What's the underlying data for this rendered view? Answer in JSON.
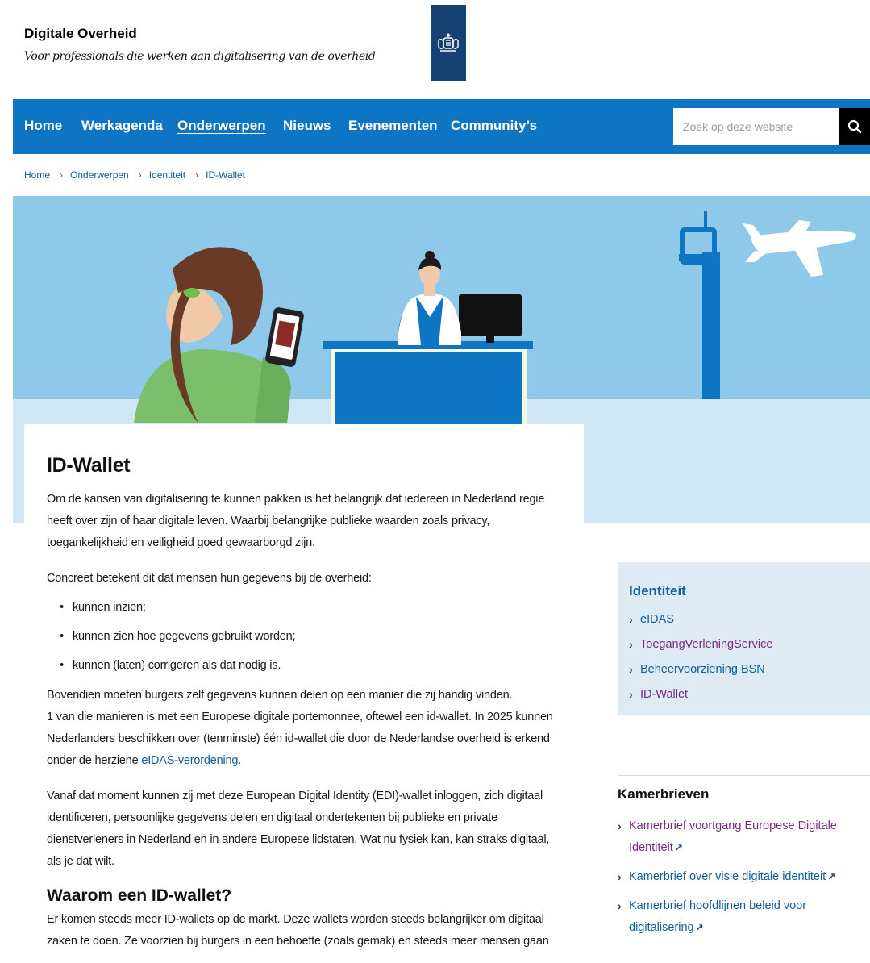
{
  "header": {
    "site_title": "Digitale Overheid",
    "tagline": "Voor professionals die werken aan digitalisering van de overheid",
    "logo_icon": "rijksoverheid-coat-of-arms-icon"
  },
  "nav": {
    "items": [
      {
        "label": "Home",
        "active": false
      },
      {
        "label": "Werkagenda",
        "active": false
      },
      {
        "label": "Onderwerpen",
        "active": true
      },
      {
        "label": "Nieuws",
        "active": false
      },
      {
        "label": "Evenementen",
        "active": false
      },
      {
        "label": "Community’s",
        "active": false
      }
    ],
    "search_placeholder": "Zoek op deze website",
    "search_icon": "search-icon"
  },
  "breadcrumb": [
    "Home",
    "Onderwerpen",
    "Identiteit",
    "ID-Wallet"
  ],
  "article": {
    "title": "ID-Wallet",
    "intro": "Om de kansen van digitalisering te kunnen pakken is het belangrijk dat iedereen in Nederland regie heeft over zijn of haar digitale leven. Waarbij belangrijke publieke waarden zoals privacy, toegankelijkheid en veiligheid goed gewaarborgd zijn.",
    "concreet": "Concreet betekent dit dat mensen hun gegevens bij de overheid:",
    "bullets": [
      "kunnen inzien;",
      "kunnen zien hoe gegevens gebruikt worden;",
      "kunnen (laten) corrigeren als dat nodig is."
    ],
    "bovendien": "Bovendien moeten burgers zelf gegevens kunnen delen op een manier die zij handig vinden.",
    "manieren": "1 van die manieren is met een Europese digitale portemonnee, oftewel een id-wallet. In 2025 kunnen Nederlanders beschikken over (tenminste) één id-wallet die door de Nederlandse overheid is erkend onder de herziene ",
    "eidas_link": "eIDAS-verordening.",
    "vanaf": "Vanaf dat moment kunnen zij met deze European Digital Identity (EDI)-wallet inloggen, zich digitaal identificeren, persoonlijke gegevens delen en digitaal ondertekenen bij publieke en private dienstverleners in Nederland en in andere Europese lidstaten. Wat nu fysiek kan, kan straks digitaal, als je dat wilt.",
    "subheading": "Waarom een ID-wallet?",
    "waarom": "Er komen steeds meer ID-wallets op de markt. Deze wallets worden steeds belangrijker om digitaal zaken te doen. Ze voorzien bij burgers in een behoefte (zoals gemak) en steeds meer mensen gaan"
  },
  "sidebar": {
    "heading": "Identiteit",
    "links": [
      {
        "label": "eIDAS",
        "color": "blue"
      },
      {
        "label": "ToegangVerleningService",
        "color": "purple"
      },
      {
        "label": "Beheervoorziening BSN",
        "color": "blue"
      },
      {
        "label": "ID-Wallet",
        "color": "purple"
      }
    ]
  },
  "kamerbrieven": {
    "heading": "Kamerbrieven",
    "links": [
      {
        "label": "Kamerbrief voortgang Europese Digitale Identiteit",
        "color": "purple"
      },
      {
        "label": "Kamerbrief over visie digitale identiteit",
        "color": "blue"
      },
      {
        "label": "Kamerbrief hoofdlijnen beleid voor digitalisering",
        "color": "blue"
      }
    ],
    "external_icon": "external-link-icon"
  },
  "colors": {
    "nav_blue": "#0e74c4",
    "logo_blue": "#154273",
    "link_blue": "#0e5f9a",
    "visited_purple": "#7a2b82",
    "hero_sky": "#8ec9ea",
    "sidebar_bg": "#deebf5"
  }
}
